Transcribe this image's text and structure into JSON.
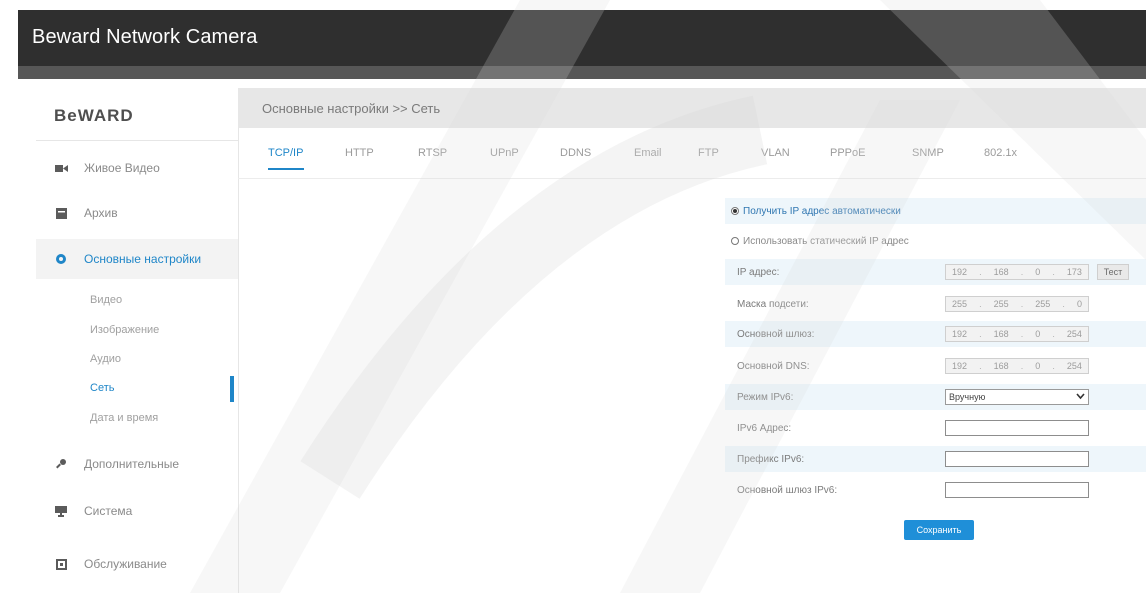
{
  "app": {
    "title": "Beward Network Camera"
  },
  "sidebar": {
    "logo": "BeWARD",
    "items": [
      {
        "label": "Живое Видео",
        "icon": "video-camera-icon"
      },
      {
        "label": "Архив",
        "icon": "archive-icon"
      },
      {
        "label": "Основные настройки",
        "icon": "gear-icon"
      },
      {
        "label": "Дополнительные",
        "icon": "tools-icon"
      },
      {
        "label": "Система",
        "icon": "monitor-icon"
      },
      {
        "label": "Обслуживание",
        "icon": "maintenance-icon"
      }
    ],
    "subitems": [
      "Видео",
      "Изображение",
      "Аудио",
      "Сеть",
      "Дата и время"
    ],
    "active_item": "Основные настройки",
    "active_subitem": "Сеть"
  },
  "header": {
    "title": "Основные настройки >> Сеть"
  },
  "tabs": [
    "TCP/IP",
    "HTTP",
    "RTSP",
    "UPnP",
    "DDNS",
    "Email",
    "FTP",
    "VLAN",
    "PPPoE",
    "SNMP",
    "802.1x"
  ],
  "active_tab": "TCP/IP",
  "form": {
    "radio_auto": "Получить IP адрес автоматически",
    "radio_static": "Использовать статический IP адрес",
    "ip_label": "IP адрес:",
    "ip_value": [
      "192",
      "168",
      "0",
      "173"
    ],
    "test_label": "Тест",
    "mask_label": "Маска подсети:",
    "mask_value": [
      "255",
      "255",
      "255",
      "0"
    ],
    "gateway_label": "Основной шлюз:",
    "gateway_value": [
      "192",
      "168",
      "0",
      "254"
    ],
    "dns_label": "Основной DNS:",
    "dns_value": [
      "192",
      "168",
      "0",
      "254"
    ],
    "ipv6_mode_label": "Режим IPv6:",
    "ipv6_mode_value": "Вручную",
    "ipv6_addr_label": "IPv6 Адрес:",
    "ipv6_prefix_label": "Префикс IPv6:",
    "ipv6_gateway_label": "Основной шлюз IPv6:",
    "save_label": "Сохранить"
  },
  "colors": {
    "accent": "#1f86c8",
    "topbar": "#2f2f2f",
    "header": "#e7e7e7",
    "row_shade": "#eef6fb"
  }
}
